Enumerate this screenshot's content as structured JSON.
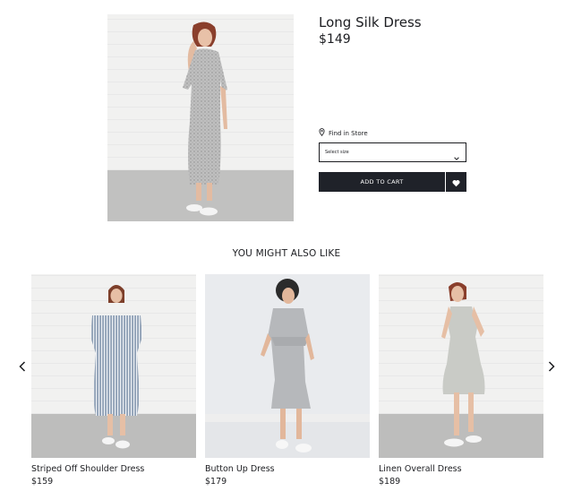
{
  "product": {
    "title": "Long Silk Dress",
    "price": "$149",
    "find_in_store": "Find in Store",
    "size_placeholder": "Select size",
    "add_to_cart": "ADD TO CART"
  },
  "recommendations": {
    "heading": "YOU MIGHT ALSO LIKE",
    "items": [
      {
        "name": "Striped Off Shoulder Dress",
        "price": "$159"
      },
      {
        "name": "Button Up Dress",
        "price": "$179"
      },
      {
        "name": "Linen Overall Dress",
        "price": "$189"
      }
    ]
  },
  "icons": {
    "location": "map-pin-icon",
    "dropdown": "chevron-down-icon",
    "wishlist": "heart-icon",
    "prev": "chevron-left-icon",
    "next": "chevron-right-icon"
  },
  "colors": {
    "button_bg": "#1f2229",
    "text": "#1c1d21"
  }
}
